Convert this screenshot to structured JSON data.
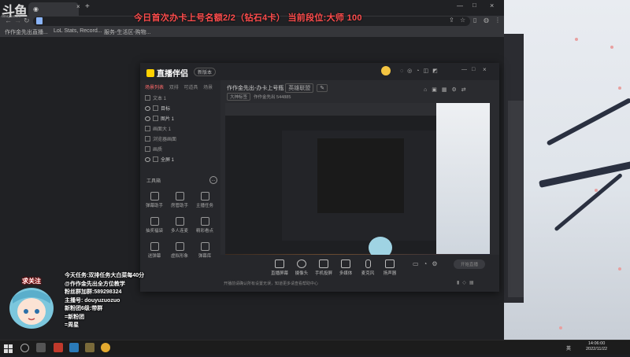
{
  "overlay": {
    "watermark": "斗鱼",
    "watermark_sub": "douyu.com",
    "title": "今日首次办卡上号名额2/2（钻石4卡）   当前段位:大师 100",
    "cheer": "求关注"
  },
  "browser": {
    "bookmarks": [
      "作作金先出直播...",
      "LoL Stats, Record...",
      "服务-生活区-购物..."
    ]
  },
  "app": {
    "logo": "直播伴侣",
    "version": "新版本",
    "left_tabs": [
      "场景列表",
      "双排",
      "可道具",
      "场景"
    ],
    "scenes": [
      "文本 1",
      "目标",
      "图片 1",
      "画面大 1",
      "浏览器画面",
      "画质",
      "全屏 1"
    ],
    "tools_title": "工具箱",
    "tools": [
      "弹幕助手",
      "房管助手",
      "主播任务",
      "抽奖福袋",
      "多人连麦",
      "精彩看点",
      "送弹幕",
      "虚拟形象",
      "弹幕库"
    ],
    "title": "作作金先出-办卡上号瓶",
    "sub_tags": [
      "英雄联盟",
      "大神标签"
    ],
    "room_id": "作作金先出 544885",
    "bottom_buttons": [
      "直播屏幕",
      "摄像头",
      "手机投屏",
      "多媒体",
      "麦克风",
      "扬声器"
    ],
    "start_label": "开始直播",
    "status_text": "开播前请确认所有设置无误，知道更多请查看帮助中心"
  },
  "info": {
    "lines": [
      "今天任务:双排任务大白菜每40分",
      "@作作金先出全方位教学",
      "粉丝群加群:589298324",
      "主播号: douyuzuozuo",
      "新粉团6级:带群",
      "=新粉团",
      "=周星"
    ]
  },
  "taskbar": {
    "clock_time": "14:06:00",
    "clock_date": "2022/11/22",
    "lang": "英"
  }
}
